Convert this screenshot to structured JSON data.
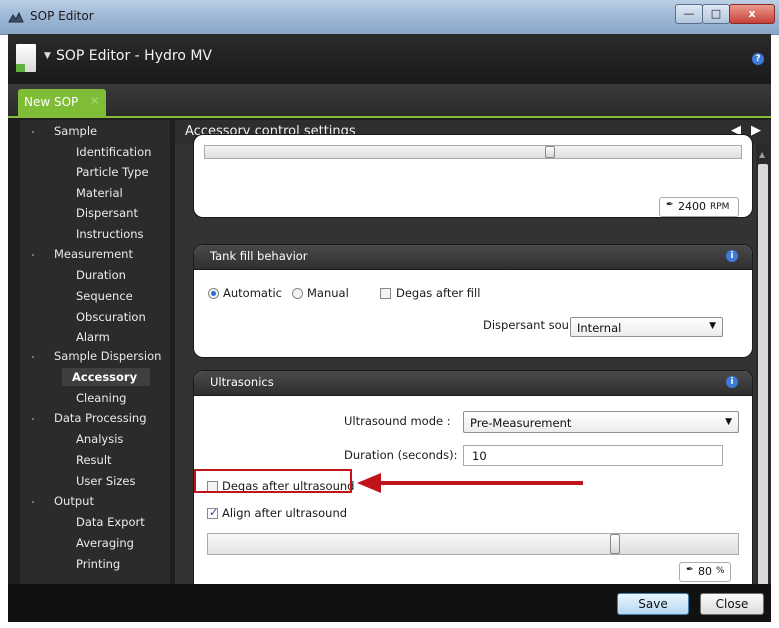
{
  "window": {
    "title": "SOP Editor",
    "controls": {
      "minimize": "—",
      "maximize": "□",
      "close": "x"
    }
  },
  "header": {
    "title": "SOP Editor - Hydro MV",
    "help_icon": "?"
  },
  "tabs": [
    {
      "label": "New SOP",
      "close": "×",
      "color": "#7fbd36"
    }
  ],
  "sidebar": {
    "groups": [
      {
        "label": "Sample",
        "items": [
          "Identification",
          "Particle Type",
          "Material",
          "Dispersant",
          "Instructions"
        ]
      },
      {
        "label": "Measurement",
        "items": [
          "Duration",
          "Sequence",
          "Obscuration",
          "Alarm"
        ]
      },
      {
        "label": "Sample Dispersion",
        "items": [
          "Accessory",
          "Cleaning"
        ],
        "active_item": "Accessory"
      },
      {
        "label": "Data Processing",
        "items": [
          "Analysis",
          "Result",
          "User Sizes"
        ]
      },
      {
        "label": "Output",
        "items": [
          "Data Export",
          "Averaging",
          "Printing"
        ]
      }
    ]
  },
  "main": {
    "title": "Accessory control settings",
    "nav_prev": "◀",
    "nav_next": "▶",
    "pump_card": {
      "readout": "2400",
      "unit": "RPM"
    },
    "tank_card": {
      "title": "Tank fill behavior",
      "info": "i",
      "radio_automatic": "Automatic",
      "radio_manual": "Manual",
      "selected": "Automatic",
      "degas_after_fill": "Degas after fill",
      "dispersant_source_label": "Dispersant source:",
      "dispersant_source_value": "Internal"
    },
    "ultrasonics_card": {
      "title": "Ultrasonics",
      "info": "i",
      "mode_label": "Ultrasound mode :",
      "mode_value": "Pre-Measurement",
      "duration_label": "Duration (seconds):",
      "duration_value": "10",
      "degas_after_ultrasound": "Degas after ultrasound",
      "degas_checked": false,
      "align_after_ultrasound": "Align after ultrasound",
      "align_checked": true,
      "power_readout": "80",
      "power_unit": "%",
      "power_fraction": 0.8
    }
  },
  "footer": {
    "save": "Save",
    "close": "Close"
  },
  "colors": {
    "accent_green": "#7fbd36",
    "info_blue": "#3c7bd8",
    "annotation_red": "#c0141a"
  },
  "icons": [
    "app-icon",
    "document-icon",
    "help-icon",
    "info-icon",
    "pump-icon",
    "checkmark-icon",
    "chevron-down-icon",
    "arrow-left-icon",
    "arrow-right-icon"
  ]
}
